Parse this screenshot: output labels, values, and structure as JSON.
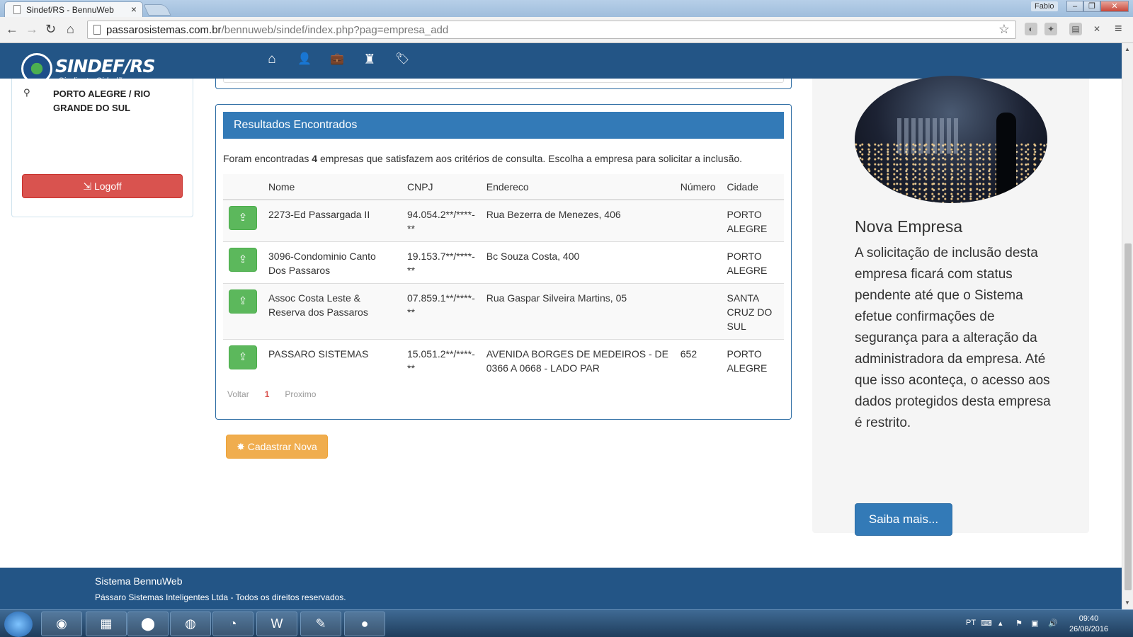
{
  "browser": {
    "tab_title": "Sindef/RS - BennuWeb",
    "tab_close": "×",
    "window_user": "Fabio",
    "url_host": "passarosistemas.com.br",
    "url_path": "/bennuweb/sindef/index.php?pag=empresa_add"
  },
  "navbar": {
    "logo_text": "SINDEF/RS",
    "logo_subtitle": "Sindicato Cidadão",
    "links": [
      {
        "icon": "home-icon",
        "glyph": "⌂"
      },
      {
        "icon": "user-icon",
        "glyph": "👤"
      },
      {
        "icon": "briefcase-icon",
        "glyph": "💼"
      },
      {
        "icon": "tower-icon",
        "glyph": "♜"
      },
      {
        "icon": "tags-icon",
        "glyph": "🏷"
      }
    ]
  },
  "sidebar": {
    "location": "PORTO ALEGRE / RIO GRANDE DO SUL",
    "logoff_label": "Logoff"
  },
  "results": {
    "heading": "Resultados Encontrados",
    "info_prefix": "Foram encontradas",
    "info_count": "4",
    "info_suffix": "empresas que satisfazem aos critérios de consulta. Escolha a empresa para solicitar a inclusão.",
    "columns": [
      "Nome",
      "CNPJ",
      "Endereco",
      "Número",
      "Cidade"
    ],
    "rows": [
      {
        "nome": "2273-Ed Passargada II",
        "cnpj": "94.054.2**/****-**",
        "endereco": "Rua Bezerra de Menezes, 406",
        "numero": "",
        "cidade": "PORTO ALEGRE"
      },
      {
        "nome": "3096-Condominio Canto Dos Passaros",
        "cnpj": "19.153.7**/****-**",
        "endereco": "Bc Souza Costa, 400",
        "numero": "",
        "cidade": "PORTO ALEGRE"
      },
      {
        "nome": "Assoc Costa Leste & Reserva dos Passaros",
        "cnpj": "07.859.1**/****-**",
        "endereco": "Rua Gaspar Silveira Martins, 05",
        "numero": "",
        "cidade": "SANTA CRUZ DO SUL"
      },
      {
        "nome": "PASSARO SISTEMAS",
        "cnpj": "15.051.2**/****-**",
        "endereco": "AVENIDA BORGES DE MEDEIROS - DE 0366 A 0668 - LADO PAR",
        "numero": "652",
        "cidade": "PORTO ALEGRE"
      }
    ],
    "pager": {
      "prev": "Voltar",
      "current": "1",
      "next": "Proximo"
    }
  },
  "cadastrar_label": "Cadastrar Nova",
  "well": {
    "title": "Nova Empresa",
    "text": "A solicitação de inclusão desta empresa ficará com status pendente até que o Sistema efetue confirmações de segurança para a alteração da administradora da empresa. Até que isso aconteça, o acesso aos dados protegidos desta empresa é restrito.",
    "button": "Saiba mais..."
  },
  "footer": {
    "line1": "Sistema BennuWeb",
    "line2": "Pássaro Sistemas Inteligentes Ltda - Todos os direitos reservados."
  },
  "taskbar": {
    "lang": "PT",
    "time": "09:40",
    "date": "26/08/2016"
  },
  "colors": {
    "navbar": "#235586",
    "primary": "#337ab7",
    "success": "#5cb85c",
    "danger": "#d9534f",
    "warning": "#f0ad4e"
  }
}
